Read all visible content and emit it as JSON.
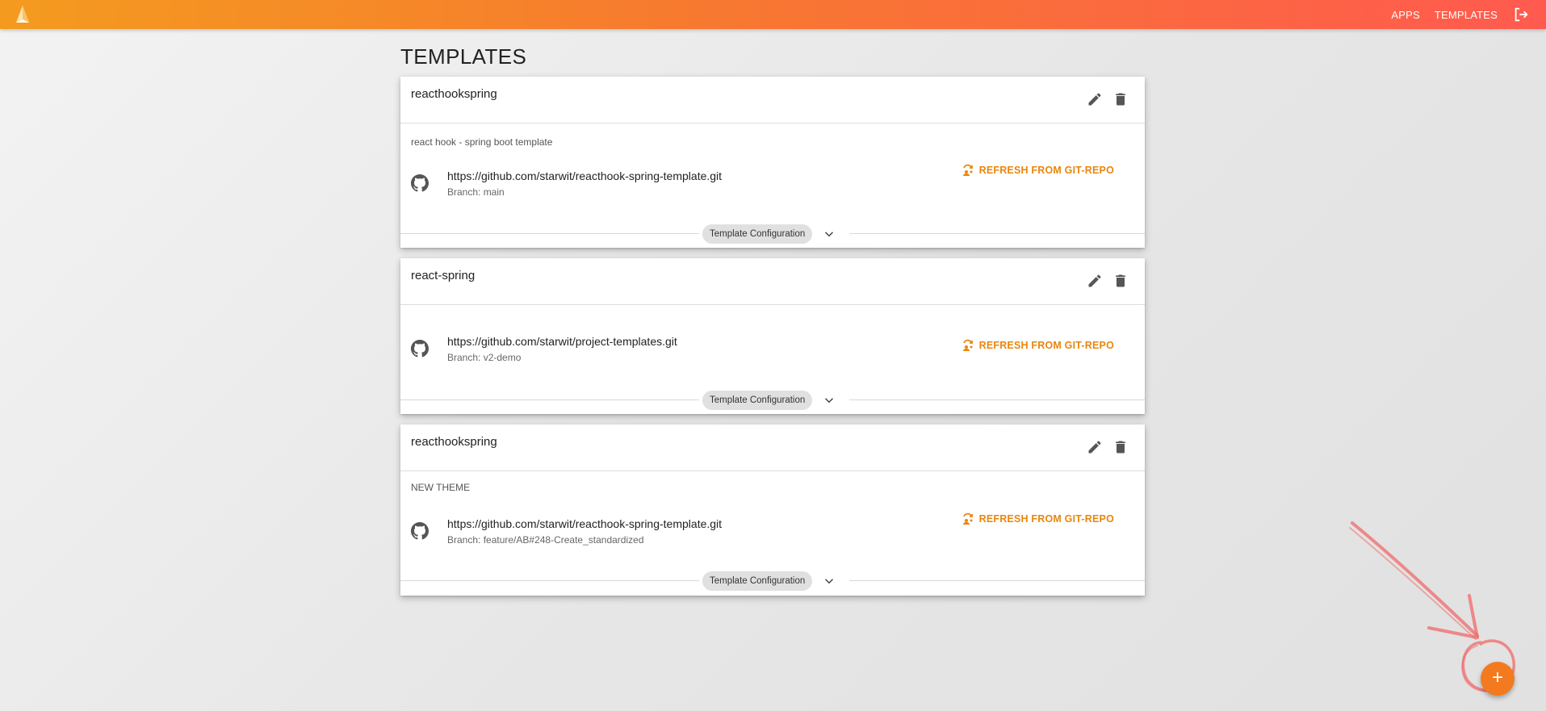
{
  "nav": {
    "apps": "APPS",
    "templates": "TEMPLATES"
  },
  "icons": {
    "logo": "building-logo-icon",
    "logout": "logout-icon",
    "edit": "pencil-icon",
    "delete": "trash-icon",
    "github": "github-icon",
    "refresh": "refresh-git-icon",
    "expand": "chevron-down-icon",
    "add": "plus-icon"
  },
  "page": {
    "title": "TEMPLATES"
  },
  "templates": [
    {
      "name": "reacthookspring",
      "description": "react hook - spring boot template",
      "repo_url": "https://github.com/starwit/reacthook-spring-template.git",
      "branch": "Branch: main",
      "refresh_label": "REFRESH FROM GIT-REPO",
      "config_label": "Template Configuration"
    },
    {
      "name": "react-spring",
      "description": "",
      "repo_url": "https://github.com/starwit/project-templates.git",
      "branch": "Branch: v2-demo",
      "refresh_label": "REFRESH FROM GIT-REPO",
      "config_label": "Template Configuration"
    },
    {
      "name": "reacthookspring",
      "description": "NEW THEME",
      "repo_url": "https://github.com/starwit/reacthook-spring-template.git",
      "branch": "Branch: feature/AB#248-Create_standardized",
      "refresh_label": "REFRESH FROM GIT-REPO",
      "config_label": "Template Configuration"
    }
  ],
  "fab": {
    "label": "+"
  },
  "colors": {
    "appbar_start": "#f49b1f",
    "appbar_end": "#ff5a4f",
    "accent": "#e8860e",
    "fab": "#f37a1f",
    "annotation": "#f06a6a"
  }
}
